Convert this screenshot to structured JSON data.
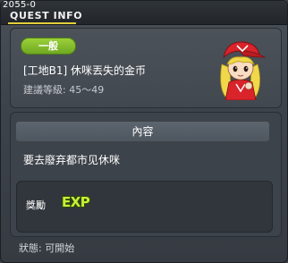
{
  "window": {
    "id": "2055-0",
    "title": "QUEST INFO"
  },
  "quest": {
    "category": "一般",
    "name": "[工地B1] 休咪丟失的金币",
    "level_requirement": "建議等級: 45～49"
  },
  "content": {
    "header": "內容",
    "text": "要去廢弃都市见休咪"
  },
  "reward": {
    "label": "獎勵",
    "exp_label": "EXP"
  },
  "status": "狀態: 可開始",
  "icons": {
    "npc": "npc-portrait-icon",
    "exp": "exp-icon"
  },
  "colors": {
    "accent": "#e2cf3a",
    "badge": "#8cc531",
    "exp": "#c8f03a"
  }
}
